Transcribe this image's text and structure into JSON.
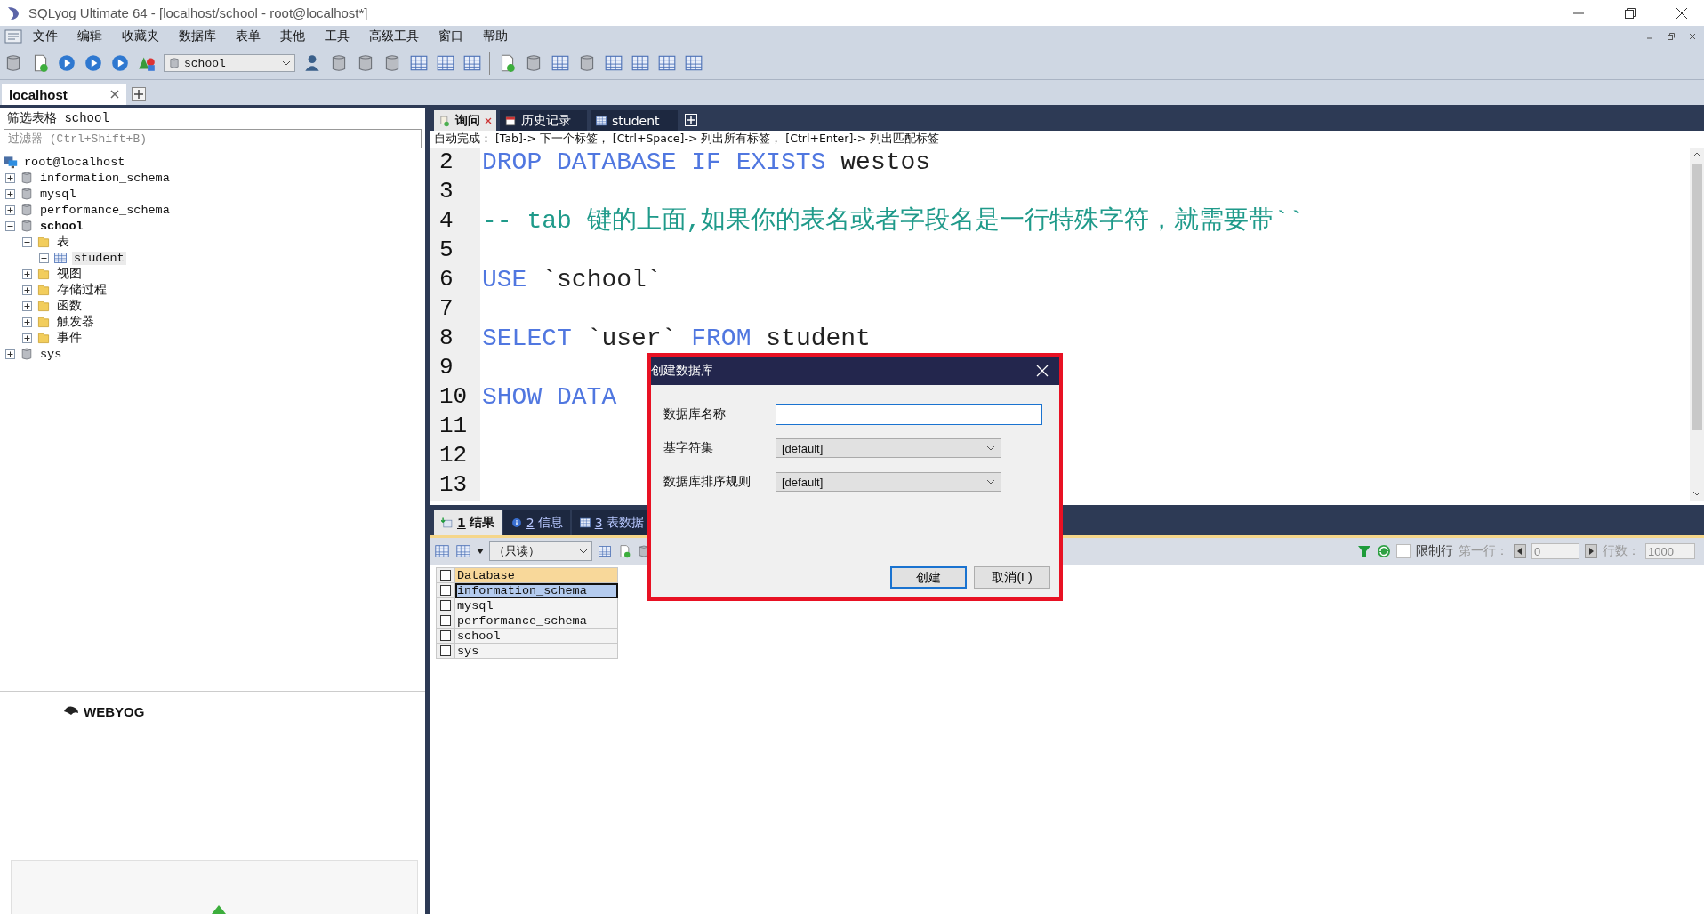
{
  "window": {
    "title": "SQLyog Ultimate 64 - [localhost/school - root@localhost*]"
  },
  "menu": [
    "文件",
    "编辑",
    "收藏夹",
    "数据库",
    "表单",
    "其他",
    "工具",
    "高级工具",
    "窗口",
    "帮助"
  ],
  "toolbar": {
    "database_select": "school"
  },
  "connection_tabs": [
    {
      "label": "localhost",
      "selected": true
    }
  ],
  "object_browser": {
    "filter_title": "筛选表格 school",
    "filter_placeholder": "过滤器 (Ctrl+Shift+B)",
    "logo": "WEBYOG",
    "tree": [
      {
        "label": "root@localhost",
        "kind": "server",
        "selected": false,
        "children": [
          {
            "label": "information_schema",
            "kind": "database",
            "expanded": false,
            "selected": false
          },
          {
            "label": "mysql",
            "kind": "database",
            "expanded": false,
            "selected": false
          },
          {
            "label": "performance_schema",
            "kind": "database",
            "expanded": false,
            "selected": false
          },
          {
            "label": "school",
            "kind": "database",
            "expanded": true,
            "active": true,
            "selected": false,
            "children": [
              {
                "label": "表",
                "kind": "folder",
                "expanded": true,
                "selected": false,
                "children": [
                  {
                    "label": "student",
                    "kind": "table",
                    "expanded": false,
                    "selected": true
                  }
                ]
              },
              {
                "label": "视图",
                "kind": "folder",
                "expanded": false,
                "selected": false
              },
              {
                "label": "存储过程",
                "kind": "folder",
                "expanded": false,
                "selected": false
              },
              {
                "label": "函数",
                "kind": "folder",
                "expanded": false,
                "selected": false
              },
              {
                "label": "触发器",
                "kind": "folder",
                "expanded": false,
                "selected": false
              },
              {
                "label": "事件",
                "kind": "folder",
                "expanded": false,
                "selected": false
              }
            ]
          },
          {
            "label": "sys",
            "kind": "database",
            "expanded": false,
            "selected": false
          }
        ]
      }
    ]
  },
  "editor_tabs": [
    {
      "label": "询问",
      "kind": "query",
      "selected": true
    },
    {
      "label": "历史记录",
      "kind": "history",
      "selected": false
    },
    {
      "label": "student",
      "kind": "table",
      "selected": false
    }
  ],
  "autocomplete_hint": "自动完成： [Tab]-> 下一个标签， [Ctrl+Space]-> 列出所有标签， [Ctrl+Enter]-> 列出匹配标签",
  "editor_lines": [
    {
      "number": "2",
      "tokens": [
        {
          "kind": "keyword",
          "text": "DROP DATABASE IF EXISTS"
        },
        {
          "kind": "text",
          "text": " westos"
        }
      ]
    },
    {
      "number": "3"
    },
    {
      "number": "4",
      "tokens": [
        {
          "kind": "comment",
          "text": "-- tab 键的上面,如果你的表名或者字段名是一行特殊字符，就需要带``"
        }
      ]
    },
    {
      "number": "5"
    },
    {
      "number": "6",
      "tokens": [
        {
          "kind": "keyword",
          "text": "USE"
        },
        {
          "kind": "text",
          "text": " `school`"
        }
      ]
    },
    {
      "number": "7"
    },
    {
      "number": "8",
      "tokens": [
        {
          "kind": "keyword",
          "text": "SELECT"
        },
        {
          "kind": "text",
          "text": " `user` "
        },
        {
          "kind": "keyword",
          "text": "FROM"
        },
        {
          "kind": "text",
          "text": " student"
        }
      ]
    },
    {
      "number": "9"
    },
    {
      "number": "10",
      "tokens": [
        {
          "kind": "keyword",
          "text": "SHOW DATA"
        }
      ]
    },
    {
      "number": "11"
    },
    {
      "number": "12"
    },
    {
      "number": "13"
    }
  ],
  "result_tabs": [
    {
      "number": "1",
      "label": "结果",
      "kind": "result",
      "selected": true
    },
    {
      "number": "2",
      "label": "信息",
      "kind": "info",
      "selected": false
    },
    {
      "number": "3",
      "label": "表数据",
      "kind": "table",
      "selected": false
    }
  ],
  "results_toolbar": {
    "mode_select": "（只读）",
    "limit_rows": {
      "label": "限制行",
      "checked": false
    },
    "first_row_label": "第一行：",
    "first_row_value": "0",
    "row_count_label": "行数：",
    "row_count_value": "1000"
  },
  "grid": {
    "columns": [
      "Database"
    ],
    "header_checked": false,
    "rows": [
      {
        "cells": [
          "information_schema"
        ],
        "selected": true,
        "checked": false
      },
      {
        "cells": [
          "mysql"
        ],
        "selected": false,
        "checked": false
      },
      {
        "cells": [
          "performance_schema"
        ],
        "selected": false,
        "checked": false
      },
      {
        "cells": [
          "school"
        ],
        "selected": false,
        "checked": false
      },
      {
        "cells": [
          "sys"
        ],
        "selected": false,
        "checked": false
      }
    ]
  },
  "dialog": {
    "title": "创建数据库",
    "fields": [
      {
        "label": "数据库名称",
        "kind": "text"
      },
      {
        "label": "基字符集",
        "kind": "select",
        "value": "[default]"
      },
      {
        "label": "数据库排序规则",
        "kind": "select",
        "value": "[default]"
      }
    ],
    "buttons": [
      {
        "label": "创建",
        "default": true
      },
      {
        "label": "取消(L)",
        "default": false
      }
    ]
  }
}
